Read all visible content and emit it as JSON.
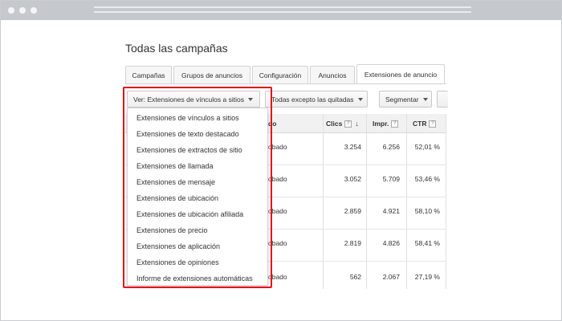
{
  "page": {
    "title": "Todas las campañas"
  },
  "tabs": [
    "Campañas",
    "Grupos de anuncios",
    "Configuración",
    "Anuncios",
    "Extensiones de anuncio"
  ],
  "toolbar": {
    "view_select": "Ver: Extensiones de vínculos a sitios",
    "filter_select": "Todas excepto las quitadas",
    "segment_select": "Segmentar"
  },
  "table": {
    "headers": {
      "status": "do",
      "clicks": "Clics",
      "impressions": "Impr.",
      "ctr": "CTR",
      "help": "?"
    },
    "rows": [
      {
        "status": "obado",
        "clicks": "3.254",
        "impressions": "6.256",
        "ctr": "52,01 %"
      },
      {
        "status": "obado",
        "clicks": "3.052",
        "impressions": "5.709",
        "ctr": "53,46 %"
      },
      {
        "status": "obado",
        "clicks": "2.859",
        "impressions": "4.921",
        "ctr": "58,10 %"
      },
      {
        "status": "obado",
        "clicks": "2.819",
        "impressions": "4.826",
        "ctr": "58,41 %"
      },
      {
        "status": "obado",
        "clicks": "562",
        "impressions": "2.067",
        "ctr": "27,19 %"
      }
    ]
  },
  "dropdown": {
    "items": [
      "Extensiones de vínculos a sitios",
      "Extensiones de texto destacado",
      "Extensiones de extractos de sitio",
      "Extensiones de llamada",
      "Extensiones de mensaje",
      "Extensiones de ubicación",
      "Extensiones de ubicación afiliada",
      "Extensiones de precio",
      "Extensiones de aplicación",
      "Extensiones de opiniones",
      "Informe de extensiones automáticas"
    ]
  },
  "colors": {
    "highlight": "#e4111b",
    "chrome": "#c5c9ce"
  },
  "icons": {
    "sort": "down-arrow-icon",
    "help": "help-icon",
    "caret": "caret-down-icon"
  }
}
